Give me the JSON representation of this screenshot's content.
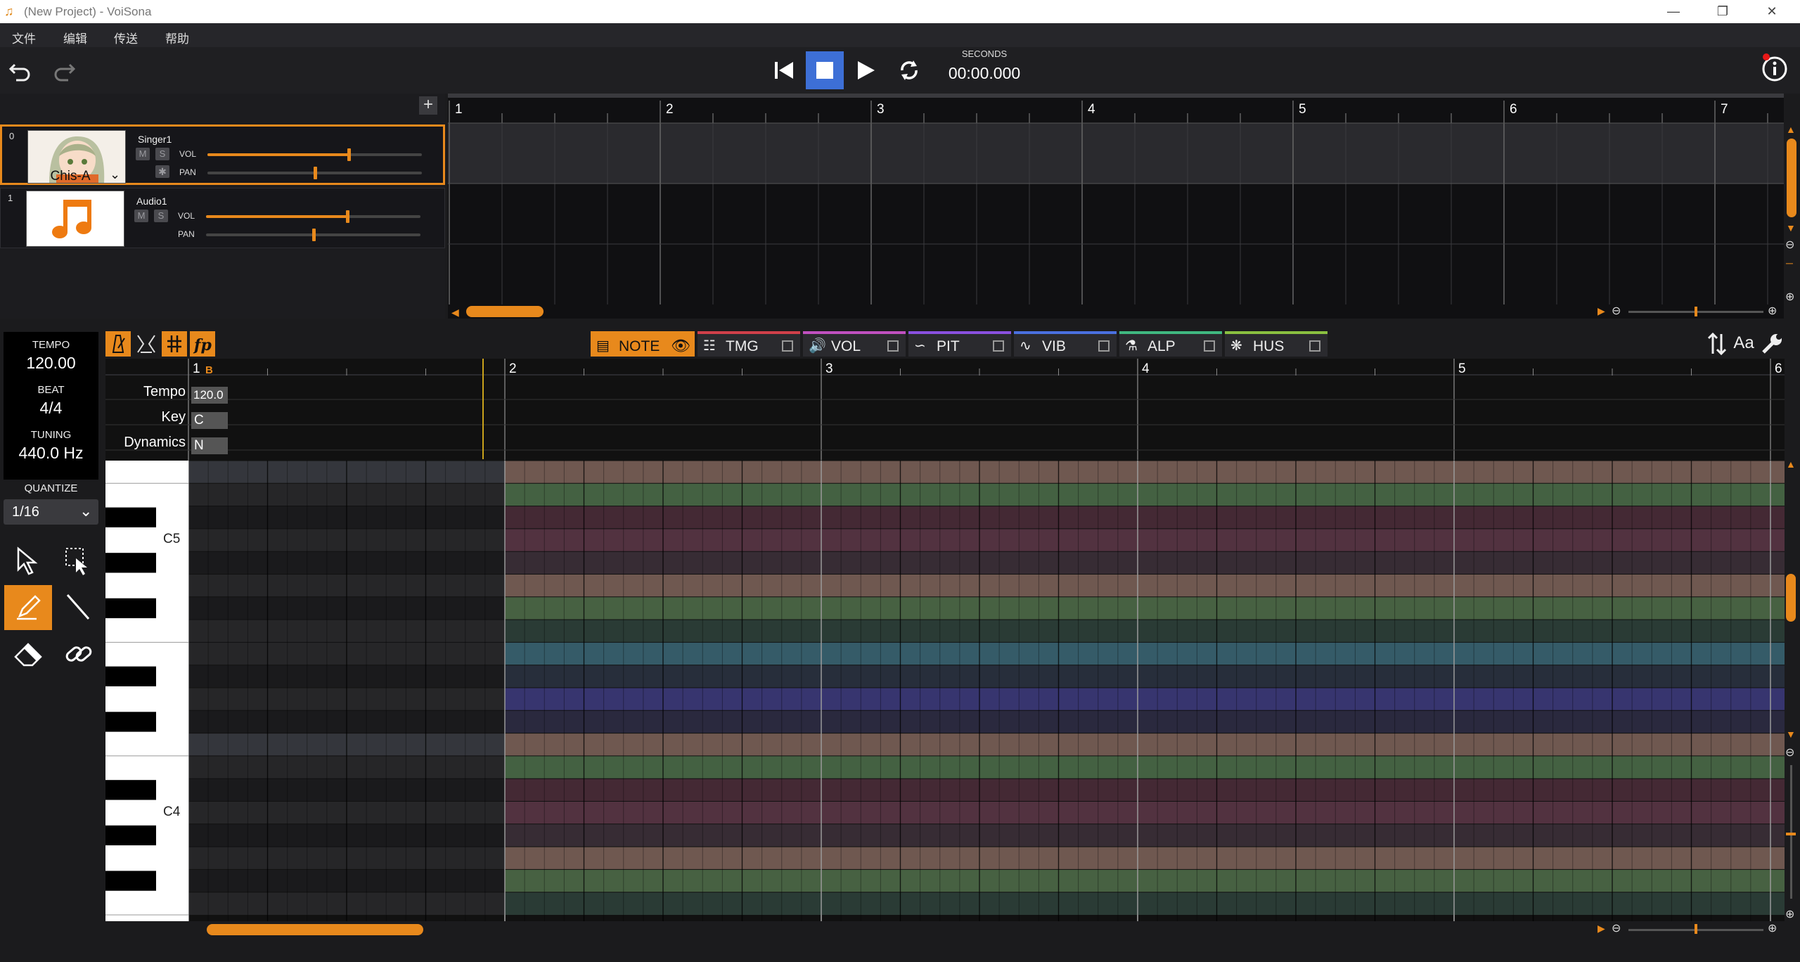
{
  "window": {
    "title": "(New Project) - VoiSona"
  },
  "menu": [
    "文件",
    "编辑",
    "传送",
    "帮助"
  ],
  "transport": {
    "time_label": "SECONDS",
    "time_value": "00:00.000"
  },
  "tracks": [
    {
      "index": "0",
      "name": "Singer1",
      "singer": "Chis-A",
      "vol_label": "VOL",
      "pan_label": "PAN",
      "mute": "M",
      "solo": "S",
      "vol": 0.66,
      "pan": 0.5
    },
    {
      "index": "1",
      "name": "Audio1",
      "vol_label": "VOL",
      "pan_label": "PAN",
      "mute": "M",
      "solo": "S",
      "vol": 0.66,
      "pan": 0.5
    }
  ],
  "arrange_ruler": [
    "1",
    "2",
    "3",
    "4",
    "5",
    "6",
    "7"
  ],
  "params": {
    "tempo_label": "TEMPO",
    "tempo": "120.00",
    "beat_label": "BEAT",
    "beat": "4/4",
    "tuning_label": "TUNING",
    "tuning": "440.0 Hz",
    "quantize_label": "QUANTIZE",
    "quantize": "1/16"
  },
  "tabs": [
    {
      "label": "NOTE",
      "color": "#e8891c"
    },
    {
      "label": "TMG",
      "color": "#d0404a"
    },
    {
      "label": "VOL",
      "color": "#c050c0"
    },
    {
      "label": "PIT",
      "color": "#8a50e0"
    },
    {
      "label": "VIB",
      "color": "#4a70e0"
    },
    {
      "label": "ALP",
      "color": "#40b880"
    },
    {
      "label": "HUS",
      "color": "#8ac040"
    }
  ],
  "aa_label": "Aa",
  "roll_ruler": [
    "1",
    "2",
    "3",
    "4",
    "5",
    "6"
  ],
  "marker": "B",
  "props": [
    {
      "label": "Tempo",
      "value": "120.0"
    },
    {
      "label": "Key",
      "value": "C"
    },
    {
      "label": "Dynamics",
      "value": "N"
    }
  ],
  "keys": {
    "c5": "C5",
    "c4": "C4"
  },
  "colors": {
    "accent": "#e8891c",
    "background": "#1b1b1d"
  }
}
